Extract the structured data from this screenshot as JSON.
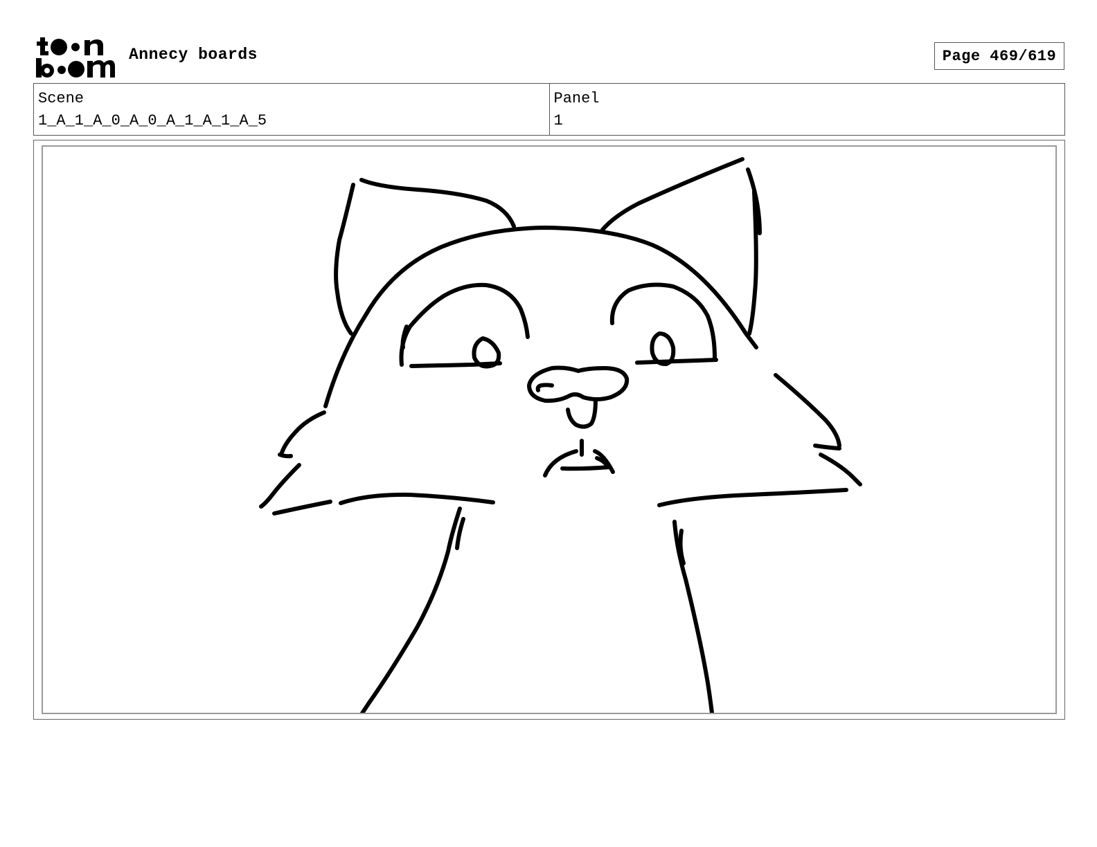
{
  "header": {
    "logo_icon": "toonboom-logo-icon",
    "project_title": "Annecy boards",
    "page_label": "Page 469/619"
  },
  "info": {
    "scene_label": "Scene",
    "scene_value": "1_A_1_A_0_A_0_A_1_A_1_A_5",
    "panel_label": "Panel",
    "panel_value": "1"
  },
  "panel_image": {
    "icon": "cat-sketch-icon"
  }
}
